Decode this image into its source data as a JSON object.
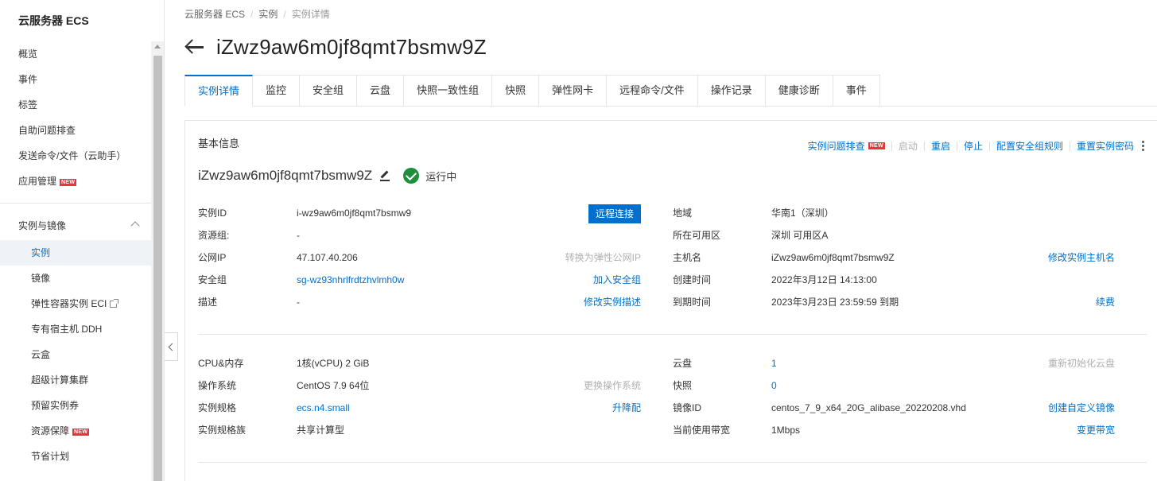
{
  "sidebar": {
    "title": "云服务器 ECS",
    "top_items": [
      {
        "label": "概览"
      },
      {
        "label": "事件"
      },
      {
        "label": "标签"
      },
      {
        "label": "自助问题排查"
      },
      {
        "label": "发送命令/文件（云助手）"
      },
      {
        "label": "应用管理",
        "badge": "NEW"
      }
    ],
    "group": "实例与镜像",
    "sub_items": [
      {
        "label": "实例",
        "active": true
      },
      {
        "label": "镜像"
      },
      {
        "label": "弹性容器实例 ECI",
        "external": true
      },
      {
        "label": "专有宿主机 DDH"
      },
      {
        "label": "云盒"
      },
      {
        "label": "超级计算集群"
      },
      {
        "label": "预留实例券"
      },
      {
        "label": "资源保障",
        "badge": "NEW"
      },
      {
        "label": "节省计划"
      }
    ]
  },
  "breadcrumb": [
    "云服务器 ECS",
    "实例",
    "实例详情"
  ],
  "page_title": "iZwz9aw6m0jf8qmt7bsmw9Z",
  "tabs": [
    "实例详情",
    "监控",
    "安全组",
    "云盘",
    "快照一致性组",
    "快照",
    "弹性网卡",
    "远程命令/文件",
    "操作记录",
    "健康诊断",
    "事件"
  ],
  "section_title": "基本信息",
  "actions": {
    "troubleshoot": "实例问题排查",
    "troubleshoot_badge": "NEW",
    "start": "启动",
    "restart": "重启",
    "stop": "停止",
    "security_rules": "配置安全组规则",
    "reset_password": "重置实例密码"
  },
  "instance": {
    "name": "iZwz9aw6m0jf8qmt7bsmw9Z",
    "status": "运行中"
  },
  "left_info": {
    "id_label": "实例ID",
    "id_value": "i-wz9aw6m0jf8qmt7bsmw9",
    "remote_btn": "远程连接",
    "rg_label": "资源组:",
    "rg_value": "-",
    "ip_label": "公网IP",
    "ip_value": "47.107.40.206",
    "ip_action": "转换为弹性公网IP",
    "sg_label": "安全组",
    "sg_value": "sg-wz93nhrlfrdtzhvlmh0w",
    "sg_action": "加入安全组",
    "desc_label": "描述",
    "desc_value": "-",
    "desc_action": "修改实例描述"
  },
  "right_info": {
    "region_label": "地域",
    "region_value": "华南1（深圳）",
    "zone_label": "所在可用区",
    "zone_value": "深圳 可用区A",
    "host_label": "主机名",
    "host_value": "iZwz9aw6m0jf8qmt7bsmw9Z",
    "host_action": "修改实例主机名",
    "created_label": "创建时间",
    "created_value": "2022年3月12日 14:13:00",
    "expire_label": "到期时间",
    "expire_value": "2023年3月23日 23:59:59 到期",
    "expire_action": "续费"
  },
  "left_spec": {
    "cpu_label": "CPU&内存",
    "cpu_value": "1核(vCPU) 2 GiB",
    "os_label": "操作系统",
    "os_value": "CentOS 7.9 64位",
    "os_action": "更换操作系统",
    "type_label": "实例规格",
    "type_value": "ecs.n4.small",
    "type_action": "升降配",
    "family_label": "实例规格族",
    "family_value": "共享计算型"
  },
  "right_spec": {
    "disk_label": "云盘",
    "disk_value": "1",
    "disk_action": "重新初始化云盘",
    "snap_label": "快照",
    "snap_value": "0",
    "image_label": "镜像ID",
    "image_value": "centos_7_9_x64_20G_alibase_20220208.vhd",
    "image_action": "创建自定义镜像",
    "bw_label": "当前使用带宽",
    "bw_value": "1Mbps",
    "bw_action": "变更带宽"
  }
}
